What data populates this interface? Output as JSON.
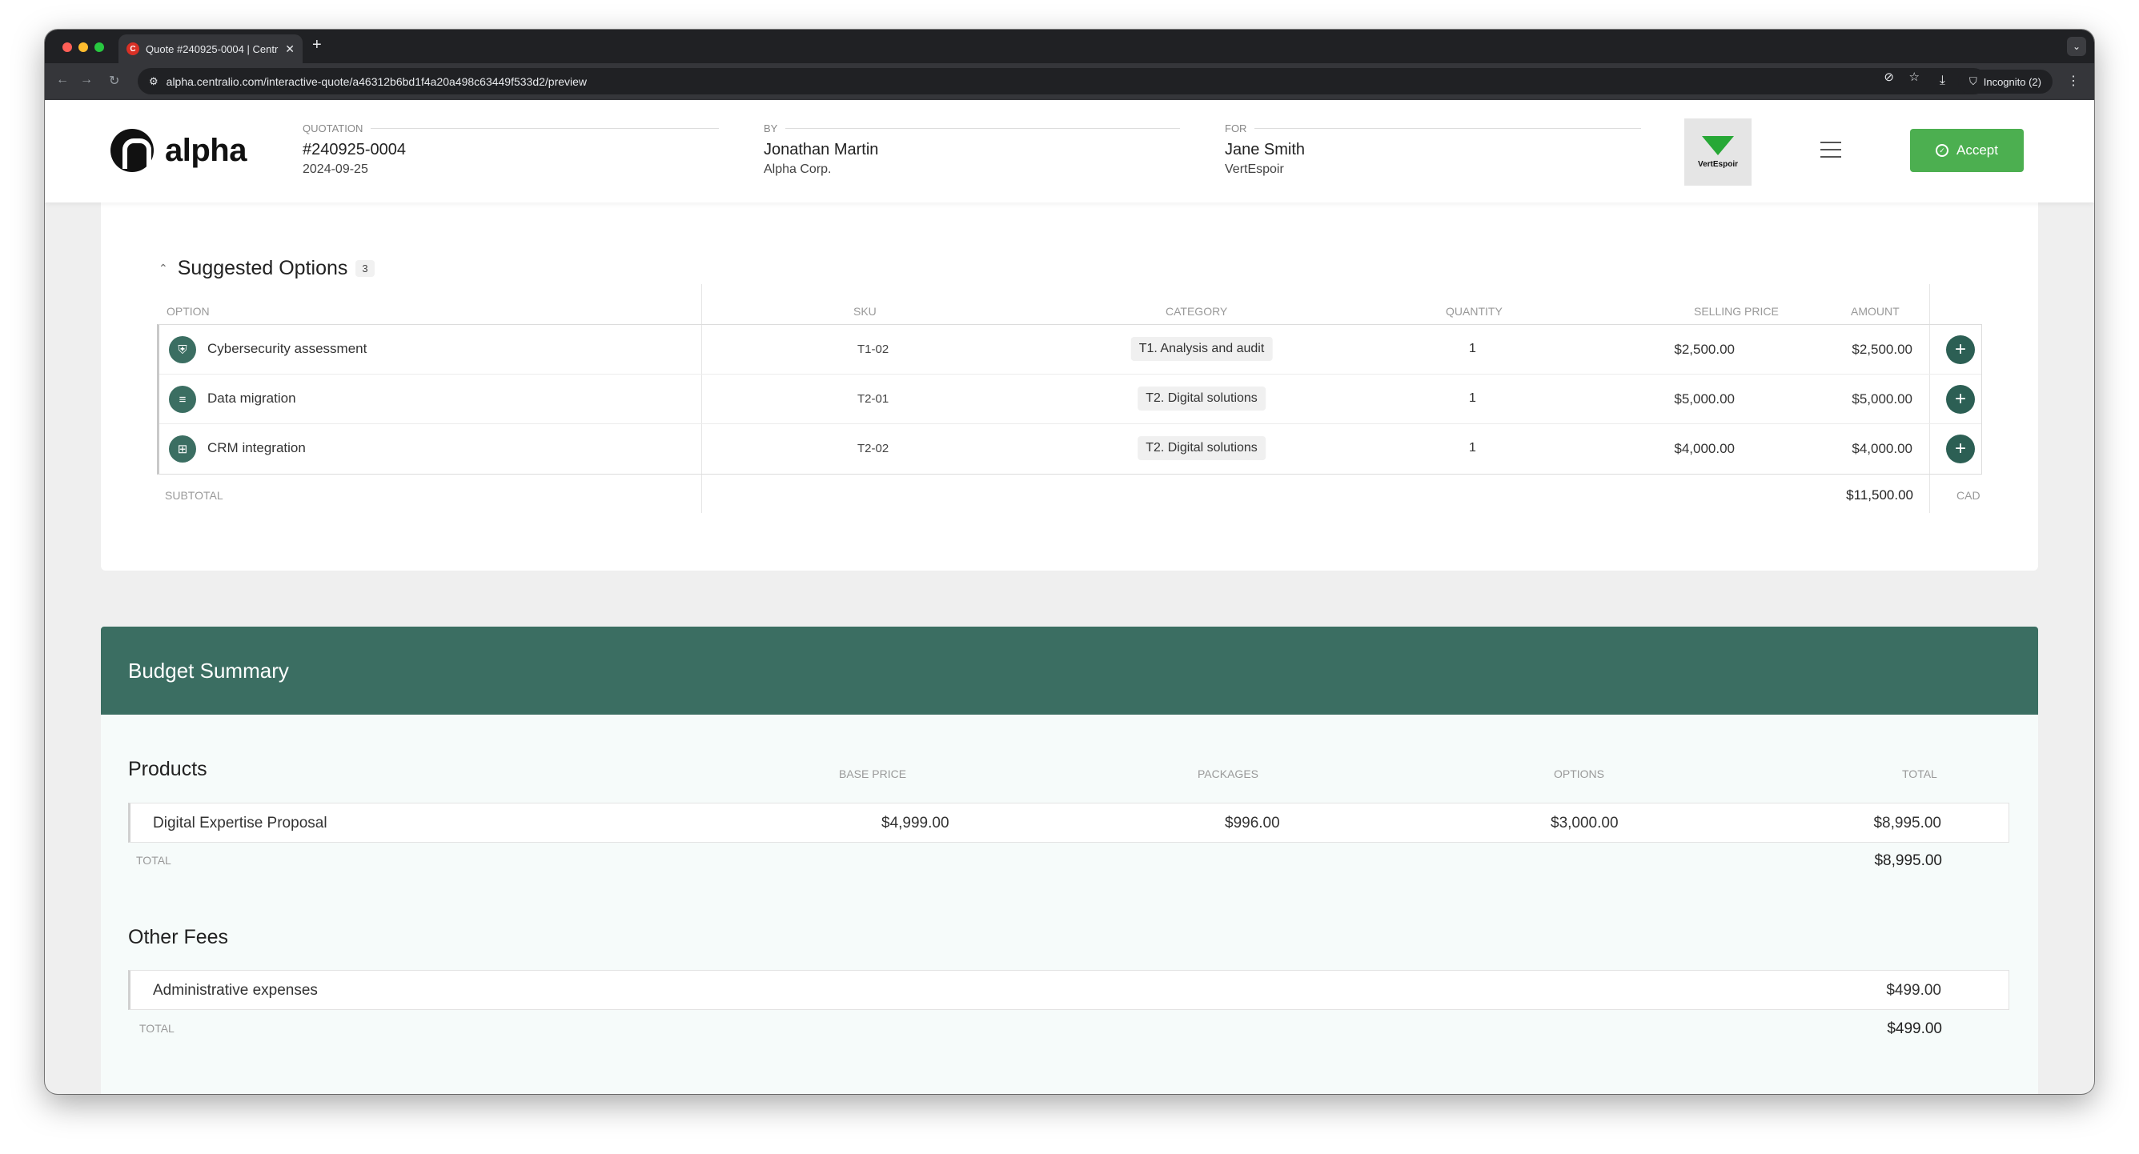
{
  "browser": {
    "tab_title": "Quote #240925-0004 | Centr",
    "tab_favicon": "C",
    "url": "alpha.centralio.com/interactive-quote/a46312b6bd1f4a20a498c63449f533d2/preview",
    "incognito_label": "Incognito (2)"
  },
  "header": {
    "brand": "alpha",
    "quotation_label": "QUOTATION",
    "quotation_number": "#240925-0004",
    "quotation_date": "2024-09-25",
    "by_label": "BY",
    "by_name": "Jonathan Martin",
    "by_company": "Alpha Corp.",
    "for_label": "FOR",
    "for_name": "Jane Smith",
    "for_company": "VertEspoir",
    "client_logo_text": "VertEspoir",
    "accept_label": "Accept"
  },
  "suggested_options": {
    "title": "Suggested Options",
    "count": "3",
    "columns": {
      "option": "OPTION",
      "sku": "SKU",
      "category": "CATEGORY",
      "quantity": "QUANTITY",
      "selling_price": "SELLING PRICE",
      "amount": "AMOUNT"
    },
    "rows": [
      {
        "icon": "shield-icon",
        "name": "Cybersecurity assessment",
        "sku": "T1-02",
        "category": "T1. Analysis and audit",
        "quantity": "1",
        "price": "$2,500.00",
        "amount": "$2,500.00"
      },
      {
        "icon": "database-icon",
        "name": "Data migration",
        "sku": "T2-01",
        "category": "T2. Digital solutions",
        "quantity": "1",
        "price": "$5,000.00",
        "amount": "$5,000.00"
      },
      {
        "icon": "network-icon",
        "name": "CRM integration",
        "sku": "T2-02",
        "category": "T2. Digital solutions",
        "quantity": "1",
        "price": "$4,000.00",
        "amount": "$4,000.00"
      }
    ],
    "subtotal_label": "SUBTOTAL",
    "subtotal_value": "$11,500.00",
    "currency": "CAD"
  },
  "budget": {
    "title": "Budget Summary",
    "products": {
      "title": "Products",
      "columns": {
        "base_price": "BASE PRICE",
        "packages": "PACKAGES",
        "options": "OPTIONS",
        "total": "TOTAL"
      },
      "rows": [
        {
          "name": "Digital Expertise Proposal",
          "base_price": "$4,999.00",
          "packages": "$996.00",
          "options": "$3,000.00",
          "total": "$8,995.00"
        }
      ],
      "total_label": "TOTAL",
      "total_value": "$8,995.00"
    },
    "other_fees": {
      "title": "Other Fees",
      "rows": [
        {
          "name": "Administrative expenses",
          "total": "$499.00"
        }
      ],
      "total_label": "TOTAL",
      "total_value": "$499.00"
    }
  },
  "colors": {
    "accent_green": "#3b6e62",
    "accept_green": "#4caf50"
  }
}
